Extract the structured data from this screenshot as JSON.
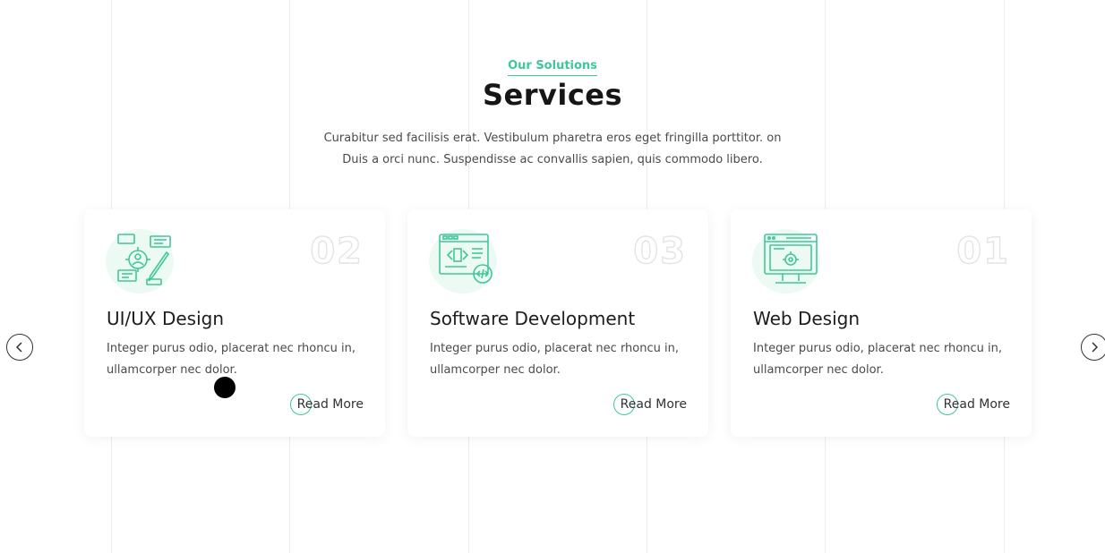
{
  "section": {
    "eyebrow": "Our Solutions",
    "title": "Services",
    "description": "Curabitur sed facilisis erat. Vestibulum pharetra eros eget fringilla porttitor. on Duis a orci nunc. Suspendisse ac convallis sapien, quis commodo libero."
  },
  "cards": [
    {
      "number": "02",
      "title": "UI/UX Design",
      "text": "Integer purus odio, placerat nec rhoncu in, ullamcorper nec dolor.",
      "link": "Read More",
      "icon": "ui-ux-design-icon"
    },
    {
      "number": "03",
      "title": "Software Development",
      "text": "Integer purus odio, placerat nec rhoncu in, ullamcorper nec dolor.",
      "link": "Read More",
      "icon": "software-development-icon"
    },
    {
      "number": "01",
      "title": "Web Design",
      "text": "Integer purus odio, placerat nec rhoncu in, ullamcorper nec dolor.",
      "link": "Read More",
      "icon": "web-design-icon"
    }
  ],
  "carousel": {
    "prev_icon": "chevron-left-icon",
    "next_icon": "chevron-right-icon"
  },
  "colors": {
    "accent": "#3fc79a",
    "icon_bg": "#edfaf4",
    "heading": "#161616"
  }
}
